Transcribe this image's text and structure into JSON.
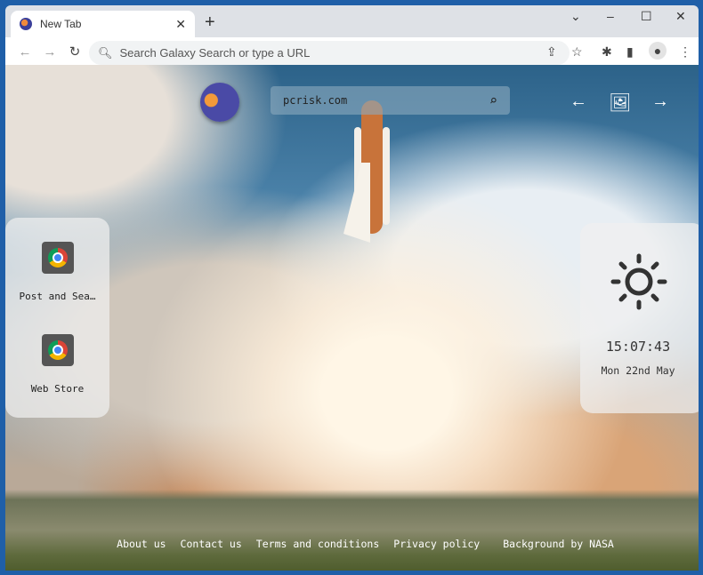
{
  "browser": {
    "tab_title": "New Tab",
    "address_placeholder": "Search Galaxy Search or type a URL"
  },
  "page": {
    "search_value": "pcrisk.com",
    "shortcuts": [
      {
        "label": "Post and Sea…",
        "icon": "chrome-icon"
      },
      {
        "label": "Web Store",
        "icon": "chrome-icon"
      }
    ],
    "weather": {
      "icon": "sun-icon",
      "time": "15:07:43",
      "date": "Mon 22nd May"
    },
    "footer": {
      "about": "About us",
      "contact": "Contact us",
      "terms": "Terms and conditions",
      "privacy": "Privacy policy",
      "background": "Background by NASA"
    }
  }
}
